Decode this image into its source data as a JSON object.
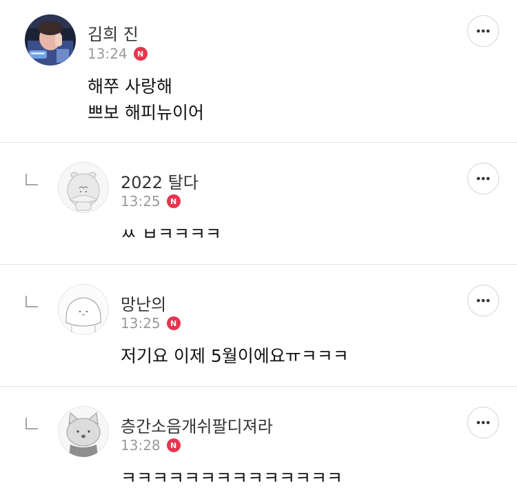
{
  "comments": [
    {
      "author": "김희 진",
      "time": "13:24",
      "badge": "N",
      "lines": [
        "해쭈 사랑해",
        "쁘보 해피뉴이어"
      ],
      "is_reply": false,
      "avatar": "photo-avatar"
    },
    {
      "author": "2022 탈다",
      "time": "13:25",
      "badge": "N",
      "lines": [
        "ㅆ ㅂㅋㅋㅋㅋ"
      ],
      "is_reply": true,
      "avatar": "hamster-avatar"
    },
    {
      "author": "망난의",
      "time": "13:25",
      "badge": "N",
      "lines": [
        "저기요 이제 5월이에요ㅠㅋㅋㅋ"
      ],
      "is_reply": true,
      "avatar": "white-blob-avatar"
    },
    {
      "author": "층간소음개쉬팔디져라",
      "time": "13:28",
      "badge": "N",
      "lines": [
        "ㅋㅋㅋㅋㅋㅋㅋㅋㅋㅋㅋㅋㅋㅋ"
      ],
      "is_reply": true,
      "avatar": "cat-avatar"
    }
  ],
  "icons": {
    "more": "more-horizontal-icon",
    "reply": "reply-arrow-icon",
    "new_badge": "new-badge-icon"
  },
  "colors": {
    "badge": "#e8344e",
    "time": "#9a9a9a",
    "divider": "#e3e3e3"
  }
}
